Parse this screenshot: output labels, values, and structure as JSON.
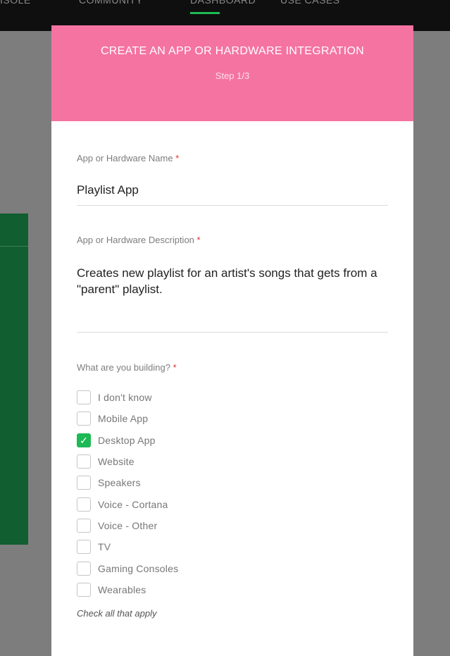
{
  "nav": {
    "items": [
      "ISOLE",
      "COMMUNITY",
      "DASHBOARD",
      "USE CASES"
    ]
  },
  "modal": {
    "title": "CREATE AN APP OR HARDWARE INTEGRATION",
    "step": "Step 1/3",
    "name_field": {
      "label": "App or Hardware Name",
      "required_mark": "*",
      "value": "Playlist App"
    },
    "description_field": {
      "label": "App or Hardware Description",
      "required_mark": "*",
      "value": "Creates new playlist for an artist's songs that gets from a \"parent\" playlist."
    },
    "building": {
      "label": "What are you building?",
      "required_mark": "*",
      "options": [
        {
          "label": "I don't know",
          "checked": false
        },
        {
          "label": "Mobile App",
          "checked": false
        },
        {
          "label": "Desktop App",
          "checked": true
        },
        {
          "label": "Website",
          "checked": false
        },
        {
          "label": "Speakers",
          "checked": false
        },
        {
          "label": "Voice - Cortana",
          "checked": false
        },
        {
          "label": "Voice - Other",
          "checked": false
        },
        {
          "label": "TV",
          "checked": false
        },
        {
          "label": "Gaming Consoles",
          "checked": false
        },
        {
          "label": "Wearables",
          "checked": false
        }
      ],
      "hint": "Check all that apply"
    }
  },
  "colors": {
    "header_pink": "#f573a0",
    "accent_green": "#1db954",
    "required_red": "#e5332a"
  }
}
